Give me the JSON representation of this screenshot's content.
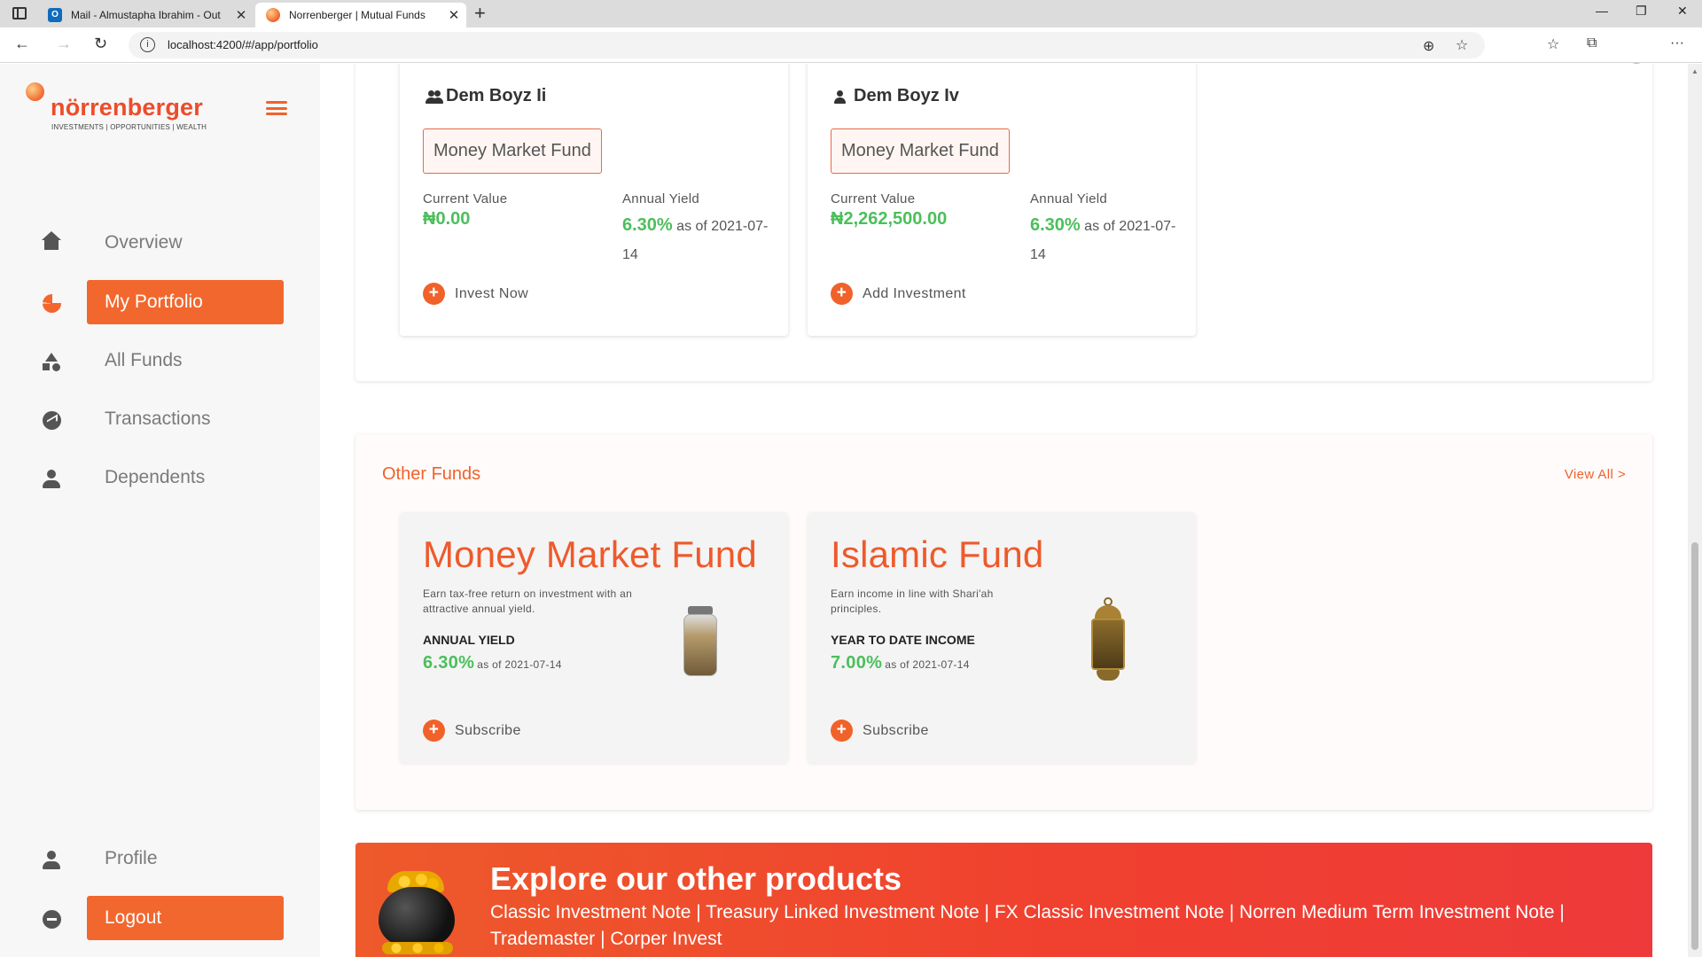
{
  "browser": {
    "tabs": [
      {
        "title": "Mail - Almustapha Ibrahim - Out",
        "close": "✕"
      },
      {
        "title": "Norrenberger | Mutual Funds",
        "close": "✕"
      }
    ],
    "url": "localhost:4200/#/app/portfolio"
  },
  "brand": {
    "name": "nörrenberger",
    "tagline": "INVESTMENTS | OPPORTUNITIES | WEALTH"
  },
  "sidebar": {
    "items": [
      {
        "label": "Overview",
        "icon": "home-icon"
      },
      {
        "label": "My Portfolio",
        "icon": "pie-chart-icon"
      },
      {
        "label": "All Funds",
        "icon": "shapes-icon"
      },
      {
        "label": "Transactions",
        "icon": "trend-icon"
      },
      {
        "label": "Dependents",
        "icon": "person-icon"
      }
    ],
    "profile_label": "Profile",
    "logout_label": "Logout"
  },
  "portfolio": {
    "cards": [
      {
        "owner": "Dem Boyz Ii",
        "owner_icon": "group-icon",
        "fund": "Money Market Fund",
        "current_value_label": "Current Value",
        "current_value": "₦0.00",
        "annual_yield_label": "Annual Yield",
        "annual_yield": "6.30%",
        "yield_date": "as of 2021-07-14",
        "action": "Invest Now"
      },
      {
        "owner": "Dem Boyz Iv",
        "owner_icon": "person-icon",
        "fund": "Money Market Fund",
        "current_value_label": "Current Value",
        "current_value": "₦2,262,500.00",
        "annual_yield_label": "Annual Yield",
        "annual_yield": "6.30%",
        "yield_date": "as of 2021-07-14",
        "action": "Add Investment"
      }
    ]
  },
  "other_funds": {
    "title": "Other Funds",
    "view_all": "View All >",
    "cards": [
      {
        "name": "Money Market Fund",
        "description": "Earn tax-free return on investment with an attractive annual yield.",
        "metric_label": "ANNUAL YIELD",
        "metric_value": "6.30%",
        "metric_date": "as of 2021-07-14",
        "action": "Subscribe",
        "image": "coin-jar-icon"
      },
      {
        "name": "Islamic Fund",
        "description": "Earn income in line with Shari'ah principles.",
        "metric_label": "YEAR TO DATE INCOME",
        "metric_value": "7.00%",
        "metric_date": "as of 2021-07-14",
        "action": "Subscribe",
        "image": "lantern-icon"
      }
    ]
  },
  "banner": {
    "title": "Explore our other products",
    "products": "Classic Investment Note | Treasury Linked Investment Note | FX Classic Investment Note | Norren Medium Term Investment Note | Trademaster | Corper Invest"
  },
  "colors": {
    "accent": "#f2672e",
    "positive": "#4cbf5c",
    "sidebar_bg": "#f7f7f7"
  }
}
